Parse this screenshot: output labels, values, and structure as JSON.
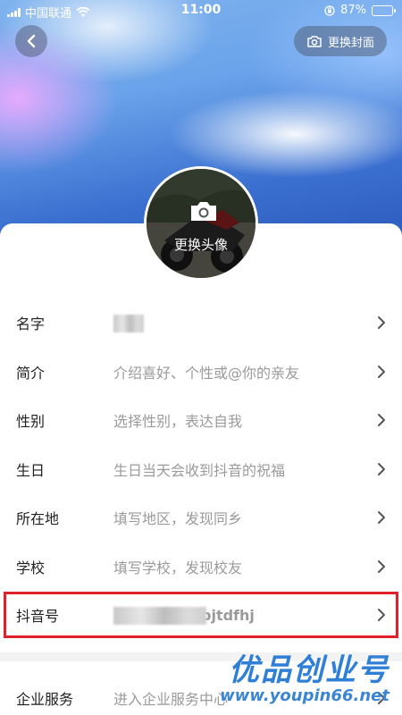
{
  "status_bar": {
    "carrier": "中国联通",
    "time": "11:00",
    "battery": "87%",
    "battery_level": 0.87
  },
  "header": {
    "back_icon": "chevron-left-icon",
    "change_cover_label": "更换封面",
    "change_cover_icon": "camera-plus-icon"
  },
  "avatar": {
    "change_label": "更换头像",
    "camera_icon": "camera-icon"
  },
  "fields": [
    {
      "label": "名字",
      "value": "",
      "placeholder": "",
      "blurred": true
    },
    {
      "label": "简介",
      "value": "",
      "placeholder": "介绍喜好、个性或@你的亲友"
    },
    {
      "label": "性别",
      "value": "",
      "placeholder": "选择性别，表达自我"
    },
    {
      "label": "生日",
      "value": "",
      "placeholder": "生日当天会收到抖音的祝福"
    },
    {
      "label": "所在地",
      "value": "",
      "placeholder": "填写地区，发现同乡"
    },
    {
      "label": "学校",
      "value": "",
      "placeholder": "填写学校，发现校友"
    },
    {
      "label": "抖音号",
      "value": "bjtdfhj",
      "placeholder": ""
    }
  ],
  "enterprise": {
    "label": "企业服务",
    "placeholder": "进入企业服务中心"
  },
  "watermark": {
    "brand": "优品创业号",
    "url": "www.youpin66.net"
  },
  "colors": {
    "highlight_border": "#e0202a",
    "watermark_blue": "#2f7fd6"
  }
}
